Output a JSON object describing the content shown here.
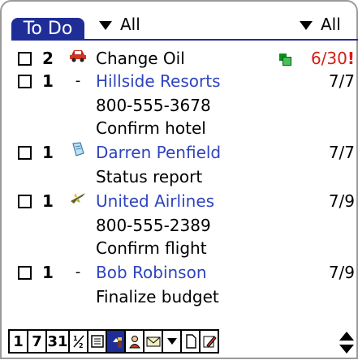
{
  "app": {
    "title": "To Do"
  },
  "filters": {
    "category_left": "All",
    "category_right": "All"
  },
  "tasks": [
    {
      "priority": "2",
      "category_icon": "car-icon",
      "description": "Change Oil",
      "linked": false,
      "details": [],
      "has_note": true,
      "due": "6/30",
      "overdue_mark": "!",
      "overdue": true
    },
    {
      "priority": "1",
      "category_icon": "none",
      "category_symbol": "-",
      "description": "Hillside Resorts",
      "linked": true,
      "details": [
        "800-555-3678",
        "Confirm hotel"
      ],
      "has_note": false,
      "due": "7/7",
      "overdue": false
    },
    {
      "priority": "1",
      "category_icon": "document-icon",
      "description": "Darren Penfield",
      "linked": true,
      "details": [
        "Status report"
      ],
      "has_note": false,
      "due": "7/7",
      "overdue": false
    },
    {
      "priority": "1",
      "category_icon": "airplane-icon",
      "description": "United Airlines",
      "linked": true,
      "details": [
        "800-555-2389",
        "Confirm flight"
      ],
      "has_note": false,
      "due": "7/9",
      "overdue": false
    },
    {
      "priority": "1",
      "category_icon": "none",
      "category_symbol": "-",
      "description": "Bob Robinson",
      "linked": true,
      "details": [
        "Finalize budget"
      ],
      "has_note": false,
      "due": "7/9",
      "overdue": false
    }
  ],
  "toolbar": {
    "day_label": "1",
    "week_label": "7",
    "month_label": "31",
    "items": [
      "day-view-icon",
      "week-view-icon",
      "month-view-icon",
      "agenda-view-icon",
      "list-view-icon",
      "todo-view-icon",
      "contacts-view-icon",
      "mail-view-icon",
      "dropdown-icon",
      "new-record-icon",
      "edit-icon"
    ]
  },
  "colors": {
    "accent": "#1f2e97",
    "link": "#2e44bf",
    "overdue": "#d81b12"
  }
}
